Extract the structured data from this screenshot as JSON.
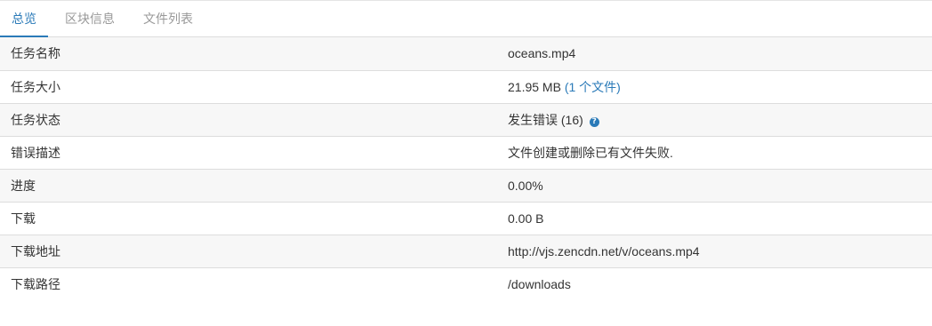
{
  "tabs": [
    {
      "label": "总览",
      "active": true
    },
    {
      "label": "区块信息",
      "active": false
    },
    {
      "label": "文件列表",
      "active": false
    }
  ],
  "rows": {
    "name": {
      "label": "任务名称",
      "value": "oceans.mp4"
    },
    "size": {
      "label": "任务大小",
      "value": "21.95 MB",
      "link": "(1 个文件)"
    },
    "status": {
      "label": "任务状态",
      "value": "发生错误 (16)",
      "help_icon": "question-circle-icon"
    },
    "error": {
      "label": "错误描述",
      "value": "文件创建或删除已有文件失败."
    },
    "progress": {
      "label": "进度",
      "value": "0.00%"
    },
    "download": {
      "label": "下载",
      "value": "0.00 B"
    },
    "url": {
      "label": "下载地址",
      "value": "http://vjs.zencdn.net/v/oceans.mp4"
    },
    "path": {
      "label": "下载路径",
      "value": "/downloads"
    }
  },
  "colors": {
    "accent": "#2a7ab8",
    "stripe": "#f7f7f7",
    "border": "#dddddd"
  }
}
